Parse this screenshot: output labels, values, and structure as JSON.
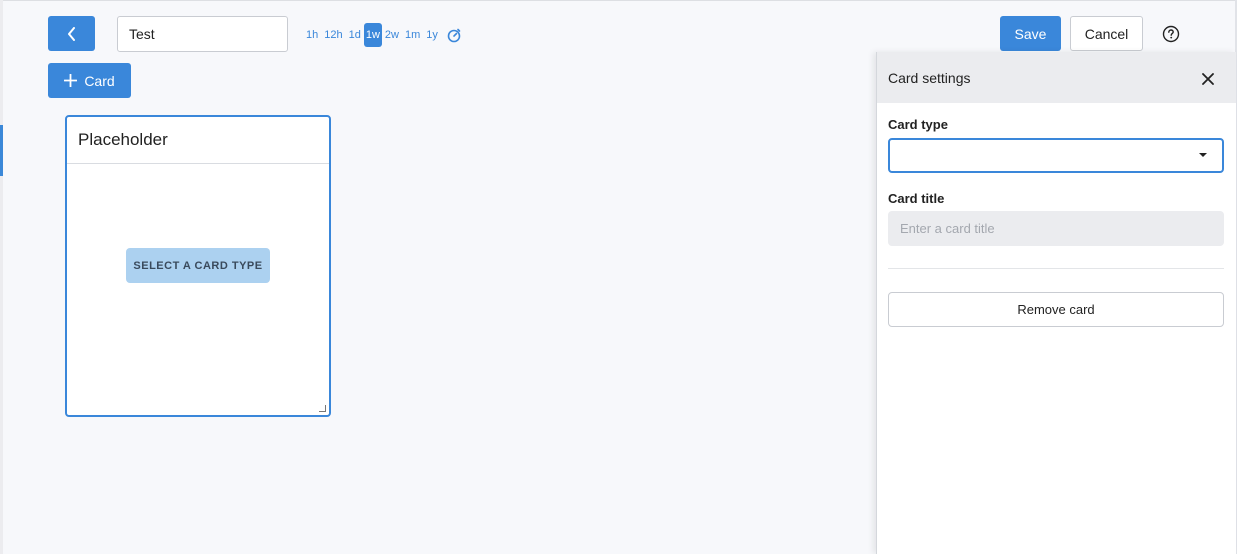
{
  "toolbar": {
    "back_icon": "chevron-left-icon",
    "dashboard_name": "Test",
    "time_ranges": [
      "1h",
      "12h",
      "1d",
      "1w",
      "2w",
      "1m",
      "1y"
    ],
    "active_range": "1w",
    "timer_icon": "stopwatch-icon",
    "save_label": "Save",
    "cancel_label": "Cancel",
    "help_icon": "question-circle-icon",
    "add_card_label": "Card",
    "add_icon": "plus-icon"
  },
  "card": {
    "title": "Placeholder",
    "select_type_label": "SELECT A CARD TYPE"
  },
  "panel": {
    "title": "Card settings",
    "close_icon": "close-icon",
    "card_type_label": "Card type",
    "card_type_value": "",
    "card_title_label": "Card title",
    "card_title_placeholder": "Enter a card title",
    "remove_label": "Remove card"
  },
  "colors": {
    "accent": "#3a87da",
    "select_button_bg": "#acd1f0",
    "panel_header_bg": "#ebecef",
    "page_bg": "#f7f8fb"
  }
}
